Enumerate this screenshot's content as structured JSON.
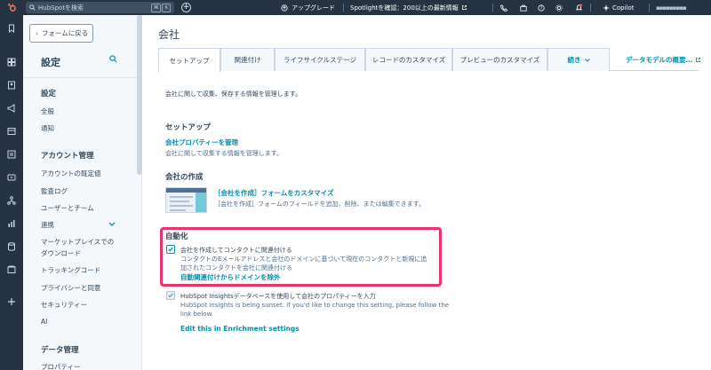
{
  "topbar": {
    "search_placeholder": "HubSpotを検索",
    "kbd1": "⌘",
    "kbd2": "K",
    "upgrade": "アップグレード",
    "spotlight": "Spotlightを確認：200以上の最新情報",
    "copilot": "Copilot",
    "account": "▪▪▪▪▪▪▪▪▪"
  },
  "sidebar": {
    "back_label": "フォームに戻る",
    "title": "設定",
    "sections": [
      {
        "heading": "設定",
        "items": [
          "全般",
          "通知"
        ]
      },
      {
        "heading": "アカウント管理",
        "items": [
          "アカウントの既定値",
          "監査ログ",
          "ユーザーとチーム",
          "連携",
          "マーケットプレイスでの",
          "ダウンロード",
          "トラッキングコード",
          "プライバシーと同意",
          "セキュリティー",
          "AI"
        ]
      },
      {
        "heading": "データ管理",
        "items": [
          "プロパティー"
        ]
      }
    ]
  },
  "main": {
    "title": "会社",
    "tabs": [
      {
        "label": "セットアップ",
        "active": true
      },
      {
        "label": "関連付け"
      },
      {
        "label": "ライフサイクルステージ"
      },
      {
        "label": "レコードのカスタマイズ"
      },
      {
        "label": "プレビューのカスタマイズ"
      },
      {
        "label": "続き"
      }
    ],
    "tab_link": "データモデルの概要…",
    "description": "会社に関して収集、保存する情報を管理します。",
    "setup": {
      "heading": "セットアップ",
      "link": "会社プロパティーを管理",
      "text": "会社に関して収集する情報を管理します。"
    },
    "create": {
      "heading": "会社の作成",
      "link": "［会社を作成］フォームをカスタマイズ",
      "text": "［会社を作成］フォームのフィールドを追加、削除、または編集できます。"
    },
    "automation": {
      "heading": "自動化",
      "cb1_label": "会社を作成してコンタクトに関連付ける",
      "cb1_line1": "コンタクトのEメールアドレスと会社のドメインに基づいて現在のコンタクトと新規に追",
      "cb1_line2": "加されたコンタクトを会社に関連付ける",
      "cb1_link": "自動関連付けからドメインを除外",
      "cb2_label": "HubSpot Insightsデータベースを使用して会社のプロパティーを入力",
      "cb2_line1": "HubSpot Insights is being sunset. If you'd like to change this setting, please follow the",
      "cb2_line2": "link below.",
      "cb2_link": "Edit this in Enrichment settings"
    }
  },
  "colors": {
    "nav_bg": "#253342",
    "accent": "#0091ae",
    "highlight": "#e8336b",
    "text": "#33475b"
  }
}
